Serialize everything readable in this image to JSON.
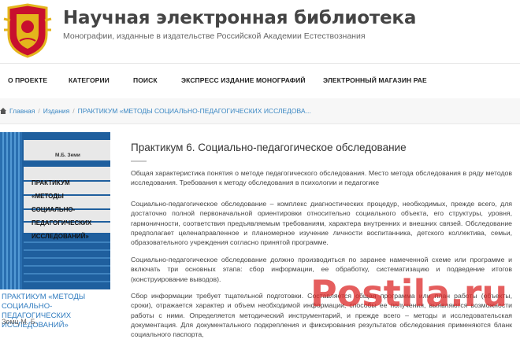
{
  "site": {
    "title": "Научная электронная библиотека",
    "subtitle": "Монографии, изданные в издательстве Российской Академии Естествознания"
  },
  "nav": {
    "items": [
      {
        "label": "О ПРОЕКТЕ"
      },
      {
        "label": "КАТЕГОРИИ"
      },
      {
        "label": "ПОИСК"
      },
      {
        "label": "ЭКСПРЕСС ИЗДАНИЕ МОНОГРАФИЙ"
      },
      {
        "label": "ЭЛЕКТРОННЫЙ МАГАЗИН РАЕ"
      }
    ]
  },
  "breadcrumb": {
    "home": "Главная",
    "section": "Издания",
    "current": "ПРАКТИКУМ «МЕТОДЫ СОЦИАЛЬНО-ПЕДАГОГИЧЕСКИХ ИССЛЕДОВА..."
  },
  "book": {
    "cover_author": "М.Б. Земи",
    "cover_title_lines": [
      "ПРАКТИКУМ",
      "«МЕТОДЫ",
      "СОЦИАЛЬНО-",
      "ПЕДАГОГИЧЕСКИХ",
      "ИССЛЕДОВАНИЙ»"
    ],
    "link": "ПРАКТИКУМ «МЕТОДЫ СОЦИАЛЬНО-ПЕДАГОГИЧЕСКИХ ИССЛЕДОВАНИЙ»",
    "author": "Земц М. Б."
  },
  "article": {
    "title": "Практикум 6. Социально-педагогическое обследование",
    "p1": "Общая характеристика понятия о методе педагогического обследования. Место метода обследования в ряду методов исследования. Требования к методу обследования в психологии и педагогике",
    "p2": "Социально-педагогическое обследование – комплекс диагностических процедур, необходимых, прежде всего, для достаточно полной первоначальной ориентировки относительно социального объекта, его структуры, уровня, гармоничности, соответствия предъявляемым требованиям, характера внутренних и внешних связей. Обследование предполагает целенаправленное и планомерное изучение личности воспитанника, детского коллектива, семьи, образовательного учреждения согласно принятой программе.",
    "p3": "Социально-педагогическое обследование должно производиться по заранее намеченной схеме или программе и включать три основных этапа: сбор информации, ее обработку, систематизацию и подведение итогов (конструирование выводов).",
    "p4": "Сбор информации требует тщательной подготовки. Составляется общая программа или план работы (объекты, сроки), отражается характер и объем необходимой информации, способы ее получения, выявляются возможности работы с ними. Определяется методический инструментарий, и прежде всего – методы и исследовательская документация. Для документального подкрепления и фиксирования результатов обследования применяются бланк социального паспорта,"
  },
  "watermark": "Postila.ru",
  "colors": {
    "link": "#3a87c3",
    "cover_blue": "#1f5f9e",
    "cover_stripe": "#2a6fb0",
    "logo_red": "#c8102e",
    "logo_gold": "#e4b51c"
  }
}
